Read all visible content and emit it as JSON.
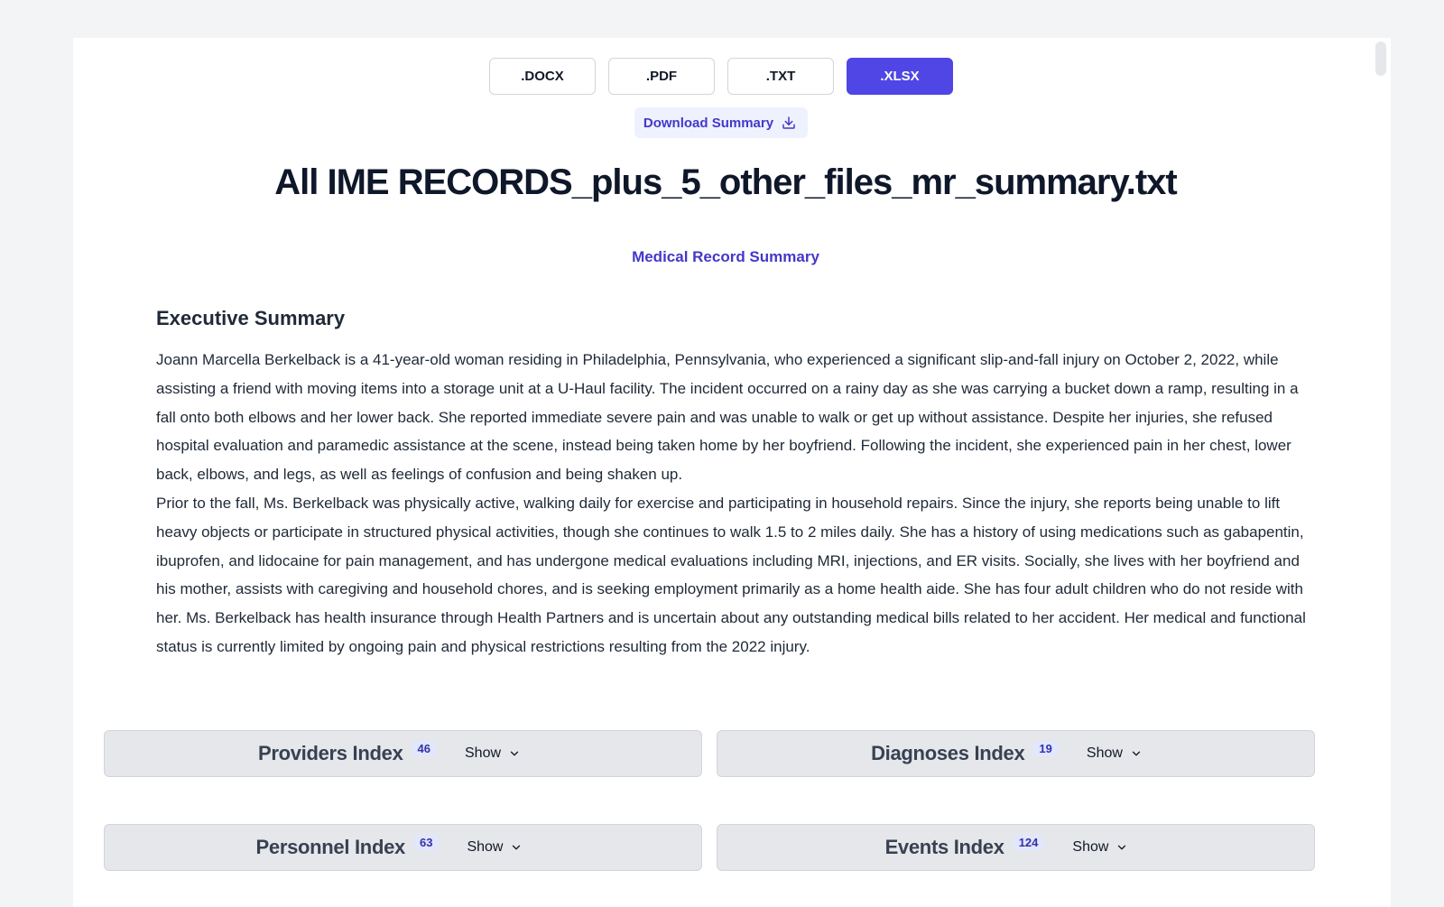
{
  "formats": [
    {
      "label": ".DOCX",
      "active": false
    },
    {
      "label": ".PDF",
      "active": false
    },
    {
      "label": ".TXT",
      "active": false
    },
    {
      "label": ".XLSX",
      "active": true
    }
  ],
  "download": {
    "label": "Download Summary",
    "icon": "download-icon"
  },
  "document": {
    "title": "All IME RECORDS_plus_5_other_files_mr_summary.txt",
    "subtitle": "Medical Record Summary"
  },
  "executive_summary": {
    "heading": "Executive Summary",
    "paragraphs": [
      "Joann Marcella Berkelback is a 41-year-old woman residing in Philadelphia, Pennsylvania, who experienced a significant slip-and-fall injury on October 2, 2022, while assisting a friend with moving items into a storage unit at a U-Haul facility. The incident occurred on a rainy day as she was carrying a bucket down a ramp, resulting in a fall onto both elbows and her lower back. She reported immediate severe pain and was unable to walk or get up without assistance. Despite her injuries, she refused hospital evaluation and paramedic assistance at the scene, instead being taken home by her boyfriend. Following the incident, she experienced pain in her chest, lower back, elbows, and legs, as well as feelings of confusion and being shaken up.",
      "Prior to the fall, Ms. Berkelback was physically active, walking daily for exercise and participating in household repairs. Since the injury, she reports being unable to lift heavy objects or participate in structured physical activities, though she continues to walk 1.5 to 2 miles daily. She has a history of using medications such as gabapentin, ibuprofen, and lidocaine for pain management, and has undergone medical evaluations including MRI, injections, and ER visits. Socially, she lives with her boyfriend and his mother, assists with caregiving and household chores, and is seeking employment primarily as a home health aide. She has four adult children who do not reside with her. Ms. Berkelback has health insurance through Health Partners and is uncertain about any outstanding medical bills related to her accident. Her medical and functional status is currently limited by ongoing pain and physical restrictions resulting from the 2022 injury."
    ]
  },
  "indexes": [
    {
      "title": "Providers Index",
      "count": "46",
      "action": "Show"
    },
    {
      "title": "Diagnoses Index",
      "count": "19",
      "action": "Show"
    },
    {
      "title": "Personnel Index",
      "count": "63",
      "action": "Show"
    },
    {
      "title": "Events Index",
      "count": "124",
      "action": "Show"
    }
  ],
  "colors": {
    "accent": "#4f46e5",
    "accent_text": "#4338ca",
    "card_bg": "#e5e7eb"
  }
}
